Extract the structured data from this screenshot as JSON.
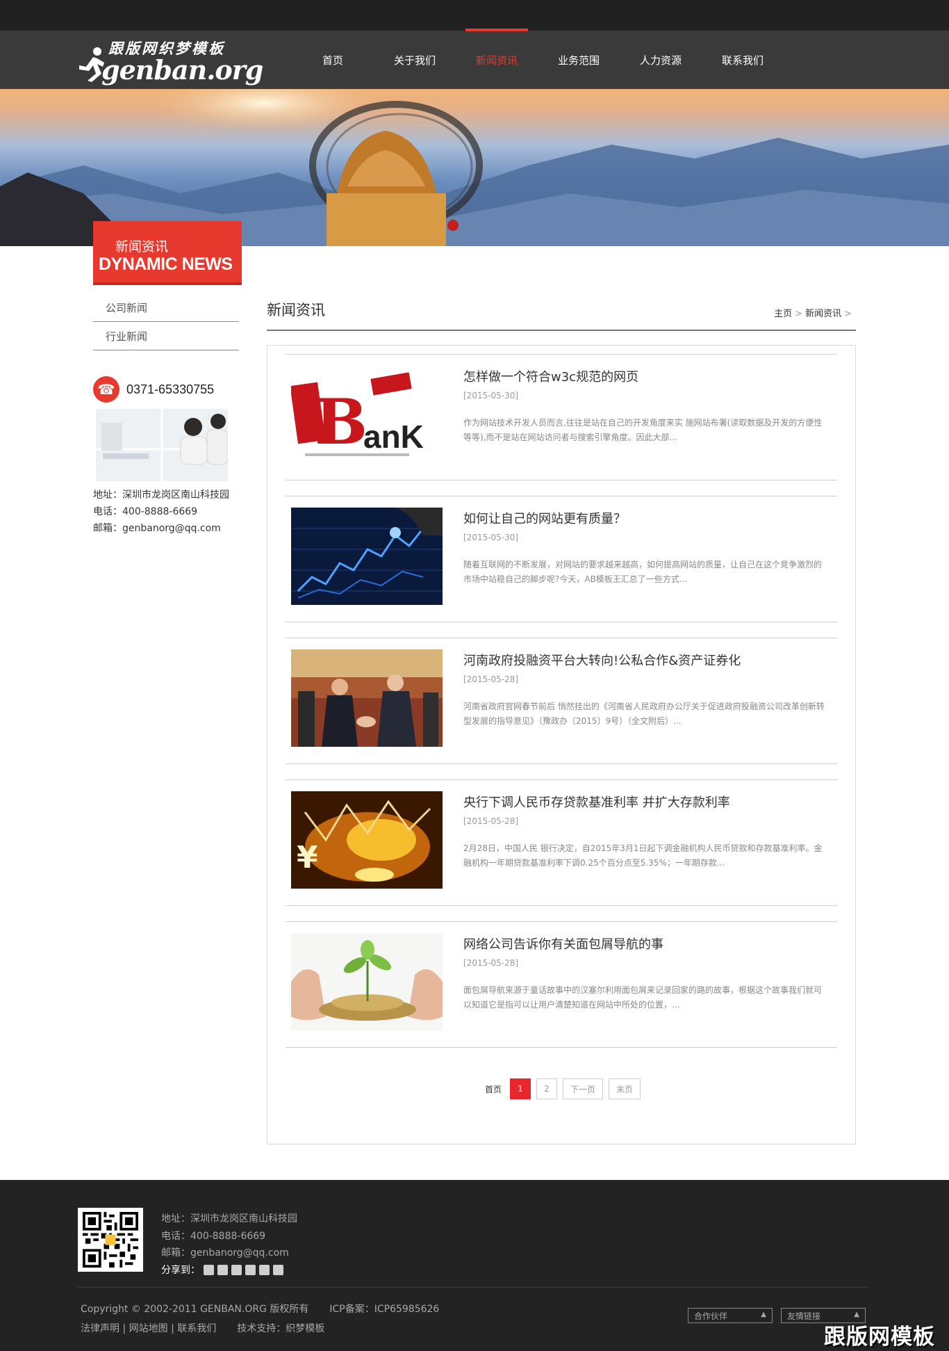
{
  "header": {
    "logo_cn": "跟版网织梦模板",
    "logo_en": "genban.org",
    "nav": [
      {
        "label": "首页",
        "active": false
      },
      {
        "label": "关于我们",
        "active": false
      },
      {
        "label": "新闻资讯",
        "active": true
      },
      {
        "label": "业务范围",
        "active": false
      },
      {
        "label": "人力资源",
        "active": false
      },
      {
        "label": "联系我们",
        "active": false
      }
    ]
  },
  "sidebar": {
    "title_cn": "新闻资讯",
    "title_en": "DYNAMIC NEWS",
    "menu": [
      {
        "label": "公司新闻"
      },
      {
        "label": "行业新闻"
      }
    ],
    "phone": "0371-65330755",
    "address": "地址：深圳市龙岗区南山科技园",
    "tel": "电话：400-8888-6669",
    "email": "邮箱：genbanorg@qq.com"
  },
  "main": {
    "title": "新闻资讯",
    "breadcrumb": {
      "home": "主页",
      "sep": ">",
      "current": "新闻资讯"
    },
    "news": [
      {
        "thumb_icon": "bank-image",
        "title": "怎样做一个符合w3c规范的网页",
        "date": "[2015-05-30]",
        "desc": "作为网站技术开发人员而言,往往是站在自己的开发角度来实 施网站布署(读取数据及开发的方便性等等),而不是站在网站访问者与搜索引擎角度。因此大部..."
      },
      {
        "thumb_icon": "stock-chart-image",
        "title": "如何让自己的网站更有质量？",
        "date": "[2015-05-30]",
        "desc": "随着互联网的不断发展，对网站的要求越来越高，如何提高网站的质量，让自己在这个竞争激烈的市场中站稳自己的脚步呢?今天，AB模板王汇总了一些方式..."
      },
      {
        "thumb_icon": "handshake-image",
        "title": "河南政府投融资平台大转向!公私合作&资产证券化",
        "date": "[2015-05-28]",
        "desc": "河南省政府官网春节前后 悄然挂出的《河南省人民政府办公厅关于促进政府投融资公司改革创新转型发展的指导意见》（豫政办〔2015〕9号）（全文附后）..."
      },
      {
        "thumb_icon": "currency-image",
        "title": "央行下调人民币存贷款基准利率 并扩大存款利率",
        "date": "[2015-05-28]",
        "desc": "2月28日，中国人民 银行决定，自2015年3月1日起下调金融机构人民币贷款和存款基准利率。金融机构一年期贷款基准利率下调0.25个百分点至5.35%；一年期存款..."
      },
      {
        "thumb_icon": "coins-plant-image",
        "title": "网络公司告诉你有关面包屑导航的事",
        "date": "[2015-05-28]",
        "desc": "面包屑导航来源于童话故事中的汉塞尔利用面包屑来记录回家的路的故事，根据这个故事我们就可以知道它是指可以让用户清楚知道在网站中所处的位置，..."
      }
    ],
    "pager": {
      "first": "首页",
      "current": "1",
      "page2": "2",
      "next": "下一页",
      "last": "末页"
    }
  },
  "footer": {
    "address": "地址：深圳市龙岗区南山科技园",
    "tel": "电话：400-8888-6669",
    "email": "邮箱：genbanorg@qq.com",
    "share_label": "分享到：",
    "copyright": "Copyright © 2002-2011 GENBAN.ORG 版权所有",
    "icp": "ICP备案：ICP65985626",
    "links": "法律声明 | 网站地图 | 联系我们",
    "support": "技术支持：织梦模板",
    "partner_select": "合作伙伴",
    "friend_select": "友情链接",
    "watermark": "跟版网模板"
  },
  "colors": {
    "accent": "#e8392e",
    "header_bg": "#3a3a3a",
    "footer_bg": "#232323"
  }
}
